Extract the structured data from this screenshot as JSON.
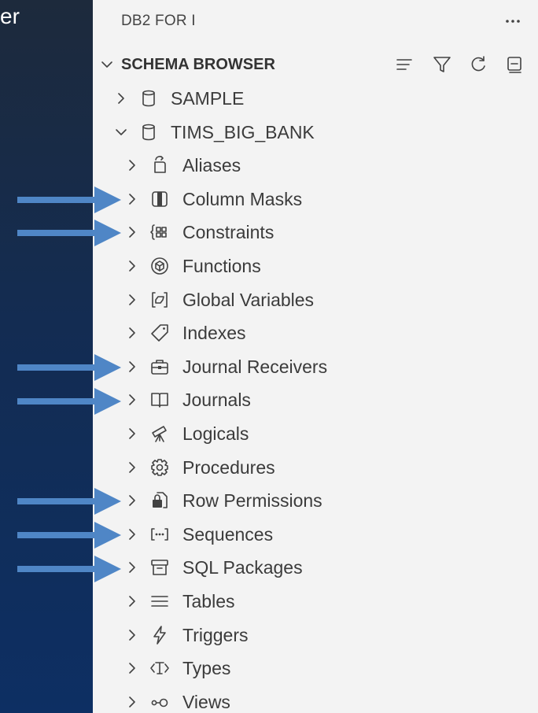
{
  "background_text": "er",
  "panel": {
    "title": "DB2 FOR I",
    "section": {
      "title": "SCHEMA BROWSER",
      "toolbar_icons": [
        "collapse-all-icon",
        "filter-icon",
        "refresh-icon",
        "collapse-icon"
      ]
    },
    "schemas": [
      {
        "label": "SAMPLE",
        "icon": "database-icon",
        "expanded": false
      },
      {
        "label": "TIMS_BIG_BANK",
        "icon": "database-icon",
        "expanded": true
      }
    ],
    "children": [
      {
        "label": "Aliases",
        "icon": "alias-icon",
        "highlighted": false
      },
      {
        "label": "Column Masks",
        "icon": "column-mask-icon",
        "highlighted": true
      },
      {
        "label": "Constraints",
        "icon": "constraint-icon",
        "highlighted": true
      },
      {
        "label": "Functions",
        "icon": "function-icon",
        "highlighted": false
      },
      {
        "label": "Global Variables",
        "icon": "global-variable-icon",
        "highlighted": false
      },
      {
        "label": "Indexes",
        "icon": "tag-icon",
        "highlighted": false
      },
      {
        "label": "Journal Receivers",
        "icon": "briefcase-icon",
        "highlighted": true
      },
      {
        "label": "Journals",
        "icon": "book-icon",
        "highlighted": true
      },
      {
        "label": "Logicals",
        "icon": "telescope-icon",
        "highlighted": false
      },
      {
        "label": "Procedures",
        "icon": "gear-icon",
        "highlighted": false
      },
      {
        "label": "Row Permissions",
        "icon": "lock-icon",
        "highlighted": true
      },
      {
        "label": "Sequences",
        "icon": "ellipsis-bracket-icon",
        "highlighted": true
      },
      {
        "label": "SQL Packages",
        "icon": "archive-icon",
        "highlighted": true
      },
      {
        "label": "Tables",
        "icon": "list-icon",
        "highlighted": false
      },
      {
        "label": "Triggers",
        "icon": "lightning-icon",
        "highlighted": false
      },
      {
        "label": "Types",
        "icon": "type-icon",
        "highlighted": false
      },
      {
        "label": "Views",
        "icon": "key-icon",
        "highlighted": false
      }
    ]
  },
  "colors": {
    "background_top": "#1d2a3c",
    "background_bottom": "#0d2f63",
    "panel": "#f3f3f3",
    "arrow": "#4f86c6",
    "text": "#3b3b3b"
  }
}
